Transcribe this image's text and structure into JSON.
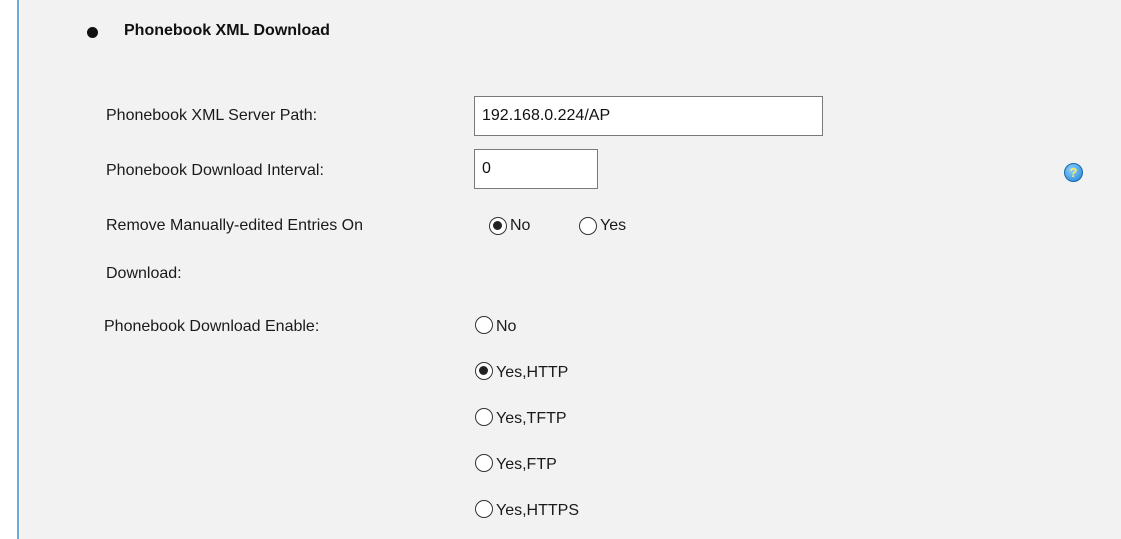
{
  "section": {
    "title": "Phonebook XML Download"
  },
  "server_path": {
    "label": "Phonebook XML Server Path:",
    "value": "192.168.0.224/AP"
  },
  "download_interval": {
    "label": "Phonebook Download Interval:",
    "value": "0"
  },
  "remove_manual": {
    "label_line1": "Remove Manually-edited Entries On",
    "label_line2": "Download:",
    "options": [
      {
        "label": "No",
        "selected": true
      },
      {
        "label": "Yes",
        "selected": false
      }
    ]
  },
  "download_enable": {
    "label": "Phonebook Download Enable:",
    "options": [
      {
        "label": "No",
        "selected": false
      },
      {
        "label": "Yes,HTTP",
        "selected": true
      },
      {
        "label": "Yes,TFTP",
        "selected": false
      },
      {
        "label": "Yes,FTP",
        "selected": false
      },
      {
        "label": "Yes,HTTPS",
        "selected": false
      }
    ]
  },
  "help": {
    "icon": "help-icon",
    "glyph": "?"
  }
}
